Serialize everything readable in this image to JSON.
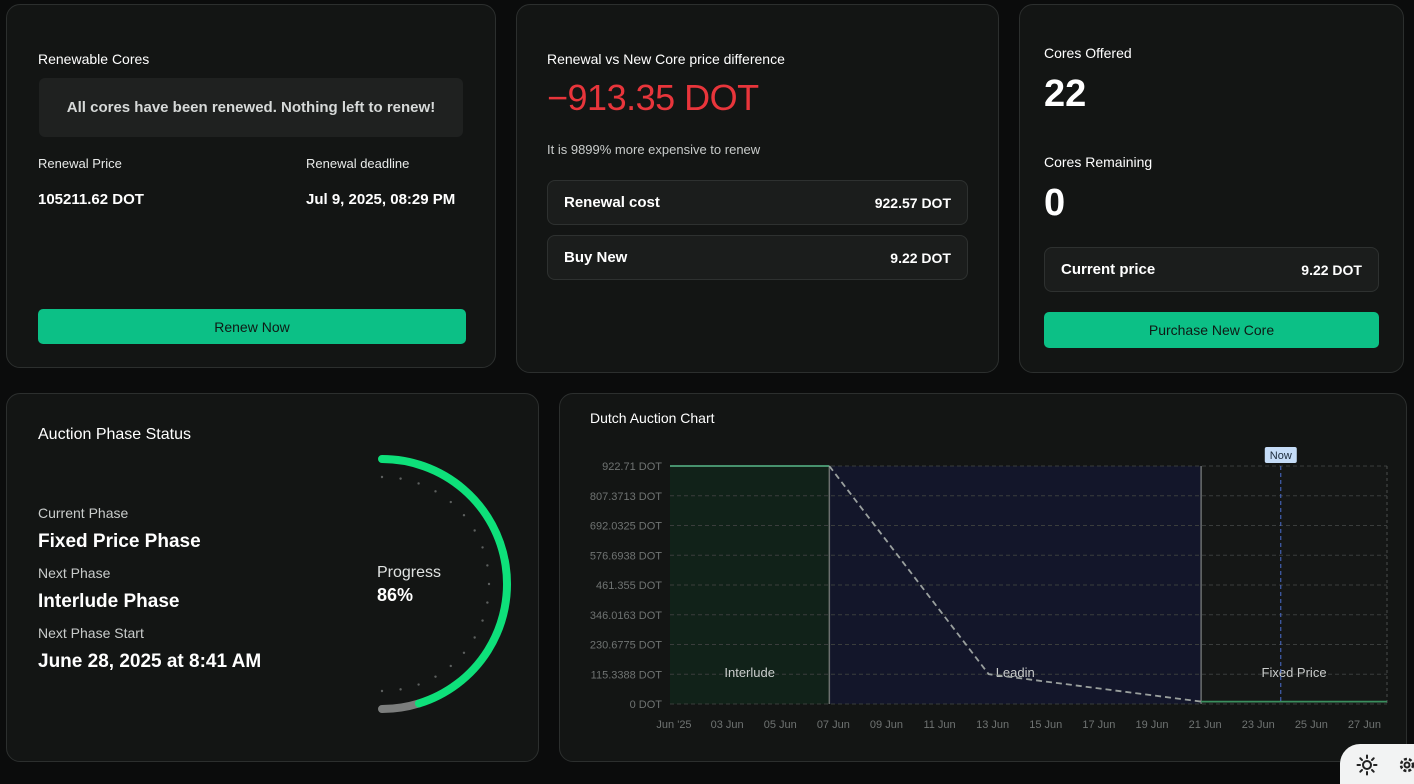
{
  "renewable": {
    "title": "Renewable Cores",
    "notice": "All cores have been renewed. Nothing left to renew!",
    "price_label": "Renewal Price",
    "price_value": "105211.62 DOT",
    "deadline_label": "Renewal deadline",
    "deadline_value": "Jul 9, 2025, 08:29 PM",
    "button": "Renew Now"
  },
  "diff": {
    "title": "Renewal vs New Core price difference",
    "value": "−913.35 DOT",
    "subtitle": "It is 9899% more expensive to renew",
    "renewal_label": "Renewal cost",
    "renewal_value": "922.57 DOT",
    "buy_label": "Buy New",
    "buy_value": "9.22 DOT",
    "accent": "#e8353b"
  },
  "offered": {
    "offered_label": "Cores Offered",
    "offered_value": "22",
    "remaining_label": "Cores Remaining",
    "remaining_value": "0",
    "price_label": "Current price",
    "price_value": "9.22 DOT",
    "button": "Purchase New Core"
  },
  "phase": {
    "title": "Auction Phase Status",
    "current_label": "Current Phase",
    "current_value": "Fixed Price Phase",
    "next_label": "Next Phase",
    "next_value": "Interlude Phase",
    "start_label": "Next Phase Start",
    "start_value": "June 28, 2025 at 8:41 AM",
    "progress_label": "Progress",
    "progress_value": "86%",
    "progress_fraction": 0.86,
    "accent": "#0ee07a"
  },
  "chart_data": {
    "type": "line",
    "title": "Dutch Auction Chart",
    "y_ticks": [
      "922.71 DOT",
      "807.3713 DOT",
      "692.0325 DOT",
      "576.6938 DOT",
      "461.355 DOT",
      "346.0163 DOT",
      "230.6775 DOT",
      "115.3388 DOT",
      "0 DOT"
    ],
    "ylim": [
      0,
      922.71
    ],
    "x_ticks": [
      "Jun '25",
      "03 Jun",
      "05 Jun",
      "07 Jun",
      "09 Jun",
      "11 Jun",
      "13 Jun",
      "15 Jun",
      "17 Jun",
      "19 Jun",
      "21 Jun",
      "23 Jun",
      "25 Jun",
      "27 Jun"
    ],
    "xlim": [
      "2025-06-01",
      "2025-06-28"
    ],
    "phases": [
      {
        "name": "Interlude",
        "start": "2025-06-01",
        "end": "2025-06-07",
        "color": "#112219"
      },
      {
        "name": "Leadin",
        "start": "2025-06-07",
        "end": "2025-06-21",
        "color": "#13162a"
      },
      {
        "name": "Fixed Price",
        "start": "2025-06-21",
        "end": "2025-06-28",
        "color": "#151716"
      }
    ],
    "series": [
      {
        "points": [
          [
            "2025-06-01",
            922.71
          ],
          [
            "2025-06-07",
            922.71
          ]
        ],
        "style": "solid",
        "color": "#4fa37a"
      },
      {
        "points": [
          [
            "2025-06-07",
            922.71
          ],
          [
            "2025-06-13",
            115.34
          ],
          [
            "2025-06-21",
            9.22
          ]
        ],
        "style": "dashed",
        "color": "#9aa09e"
      },
      {
        "points": [
          [
            "2025-06-21",
            9.22
          ],
          [
            "2025-06-28",
            9.22
          ]
        ],
        "style": "solid",
        "color": "#3b8f5f"
      }
    ],
    "now_label": "Now",
    "now_date": "2025-06-24",
    "grid": true
  }
}
